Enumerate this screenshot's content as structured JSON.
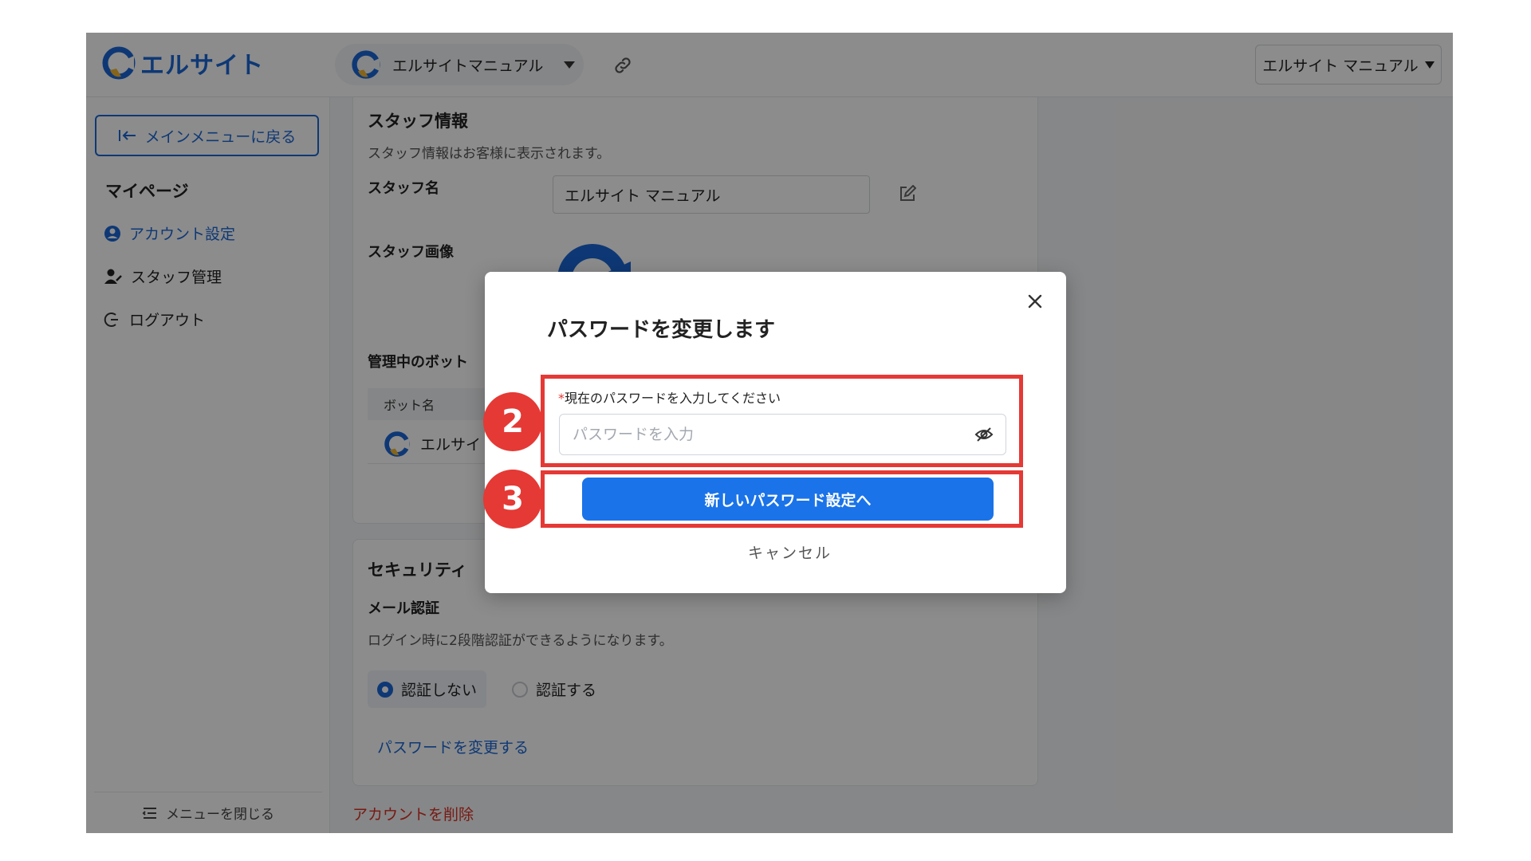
{
  "brand": {
    "name": "エルサイト",
    "color": "#1a66d6"
  },
  "topbar": {
    "bot_name": "エルサイトマニュアル",
    "user_name": "エルサイト マニュアル"
  },
  "sidebar": {
    "back_label": "メインメニューに戻る",
    "heading": "マイページ",
    "items": [
      {
        "label": "アカウント設定",
        "icon": "user-circle-icon",
        "active": true
      },
      {
        "label": "スタッフ管理",
        "icon": "staff-icon",
        "active": false
      },
      {
        "label": "ログアウト",
        "icon": "logout-icon",
        "active": false
      }
    ],
    "footer_label": "メニューを閉じる"
  },
  "staff_info": {
    "title": "スタッフ情報",
    "description": "スタッフ情報はお客様に表示されます。",
    "name_label": "スタッフ名",
    "name_value": "エルサイト マニュアル",
    "image_label": "スタッフ画像",
    "bots_label": "管理中のボット",
    "bots_table_header": "ボット名",
    "bot_row_name": "エルサイ"
  },
  "security": {
    "title": "セキュリティ",
    "mail_auth_label": "メール認証",
    "mail_auth_desc": "ログイン時に2段階認証ができるようになります。",
    "options": [
      "認証しない",
      "認証する"
    ],
    "selected_option": "認証しない",
    "change_password_link": "パスワードを変更する"
  },
  "delete_account_link": "アカウントを削除",
  "modal": {
    "title": "パスワードを変更します",
    "required_mark": "*",
    "field_label": "現在のパスワードを入力してください",
    "placeholder": "パスワードを入力",
    "primary_button": "新しいパスワード設定へ",
    "cancel_button": "キャンセル"
  },
  "callouts": {
    "step_a": "2",
    "step_b": "3",
    "color": "#e53935"
  }
}
